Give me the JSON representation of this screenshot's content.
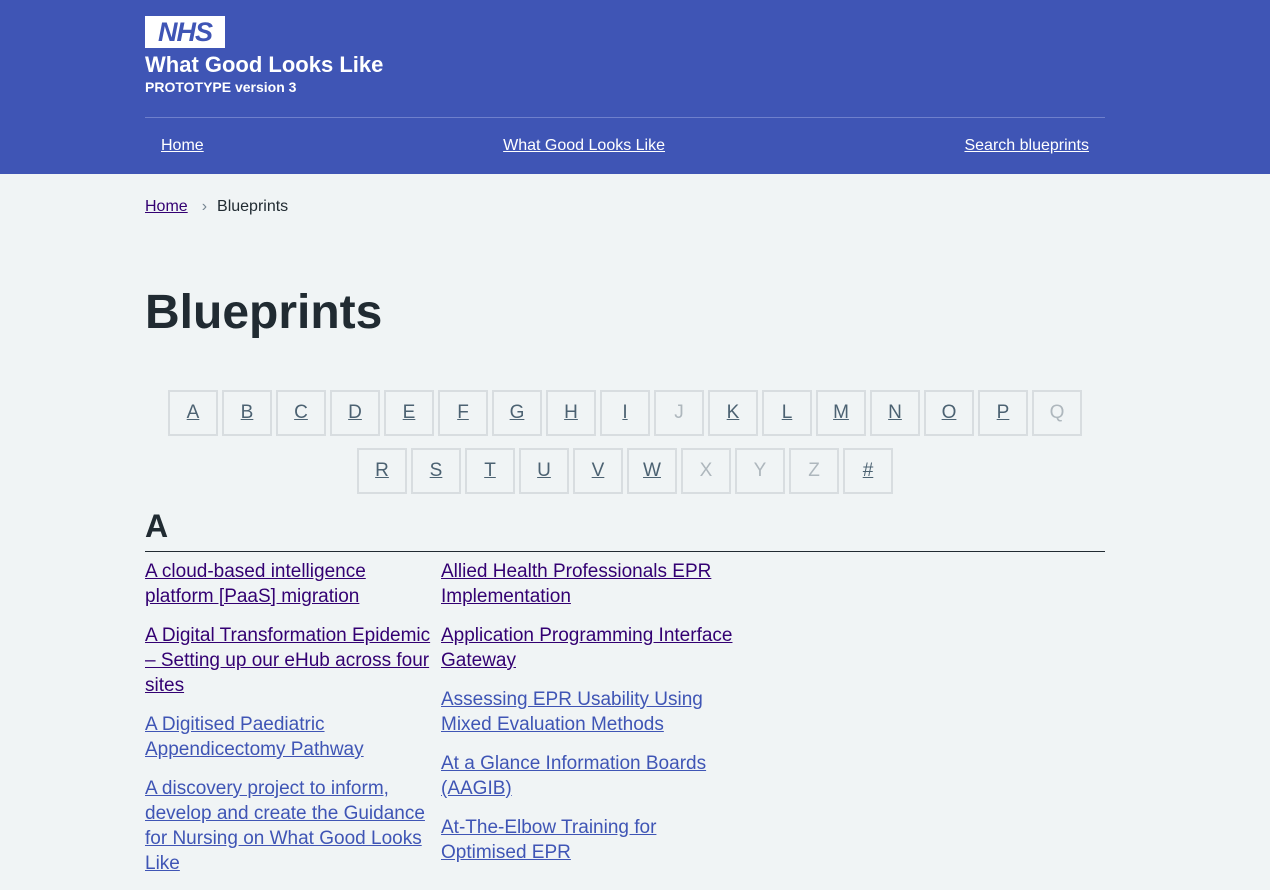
{
  "header": {
    "logo_text": "NHS",
    "service_name": "What Good Looks Like",
    "service_sub": "PROTOTYPE version 3",
    "nav": [
      "Home",
      "What Good Looks Like",
      "Search blueprints"
    ]
  },
  "breadcrumb": {
    "home": "Home",
    "separator": "›",
    "current": "Blueprints"
  },
  "page_title": "Blueprints",
  "az_row1": [
    "A",
    "B",
    "C",
    "D",
    "E",
    "F",
    "G",
    "H",
    "I",
    "J",
    "K",
    "L",
    "M",
    "N",
    "O",
    "P",
    "Q"
  ],
  "az_row2": [
    "R",
    "S",
    "T",
    "U",
    "V",
    "W",
    "X",
    "Y",
    "Z",
    "#"
  ],
  "az_disabled": [
    "J",
    "Q",
    "X",
    "Y",
    "Z"
  ],
  "section_letter": "A",
  "column1": [
    {
      "title": "A cloud-based intelligence platform [PaaS] migration",
      "visited": true
    },
    {
      "title": "A Digital Transformation Epidemic – Setting up our eHub across four sites",
      "visited": true
    },
    {
      "title": "A Digitised Paediatric Appendicectomy Pathway",
      "visited": false
    },
    {
      "title": "A discovery project to inform, develop and create the Guidance for Nursing on What Good Looks Like",
      "visited": false
    }
  ],
  "column2": [
    {
      "title": "Allied Health Professionals EPR Implementation",
      "visited": true
    },
    {
      "title": "Application Programming Interface Gateway",
      "visited": true
    },
    {
      "title": "Assessing EPR Usability Using Mixed Evaluation Methods",
      "visited": false
    },
    {
      "title": "At a Glance Information Boards (AAGIB)",
      "visited": false
    },
    {
      "title": "At-The-Elbow Training for Optimised EPR",
      "visited": false
    }
  ],
  "colors": {
    "header_bg": "#3f55b5",
    "page_bg": "#f0f4f5",
    "link": "#3f55b5",
    "visited": "#330072",
    "text": "#212b32"
  }
}
